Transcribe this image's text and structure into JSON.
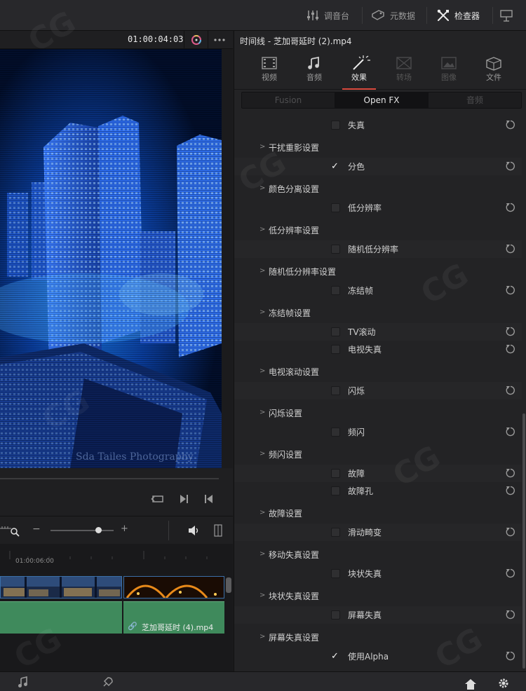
{
  "topbar": {
    "items": [
      {
        "label": "调音台",
        "icon": "mixer-icon"
      },
      {
        "label": "元数据",
        "icon": "metadata-tag-icon"
      },
      {
        "label": "检查器",
        "icon": "inspector-tools-icon"
      }
    ]
  },
  "viewer": {
    "timecode": "01:00:04:03",
    "overlay_text": "Sda Tailes Photography"
  },
  "timeline": {
    "ruler_timecode": "01:00:06:00",
    "audio_clip_name": "芝加哥延时 (4).mp4"
  },
  "inspector": {
    "title": "时间线 - 芝加哥延时 (2).mp4",
    "tabs": [
      {
        "label": "视频",
        "icon": "video-icon",
        "state": "normal"
      },
      {
        "label": "音频",
        "icon": "music-note-icon",
        "state": "normal"
      },
      {
        "label": "效果",
        "icon": "magic-wand-icon",
        "state": "active"
      },
      {
        "label": "转场",
        "icon": "transition-icon",
        "state": "dim"
      },
      {
        "label": "图像",
        "icon": "image-icon",
        "state": "dim"
      },
      {
        "label": "文件",
        "icon": "file-icon",
        "state": "normal"
      }
    ],
    "subtabs": [
      "Fusion",
      "Open FX",
      "音频"
    ],
    "active_subtab": "Open FX",
    "rows": [
      {
        "type": "check",
        "label": "失真",
        "checked": false
      },
      {
        "type": "group",
        "label": "干扰重影设置"
      },
      {
        "type": "check",
        "label": "分色",
        "checked": true
      },
      {
        "type": "group",
        "label": "颜色分离设置"
      },
      {
        "type": "check",
        "label": "低分辨率",
        "checked": false
      },
      {
        "type": "group",
        "label": "低分辨率设置"
      },
      {
        "type": "check",
        "label": "随机低分辨率",
        "checked": false
      },
      {
        "type": "group",
        "label": "随机低分辨率设置"
      },
      {
        "type": "check",
        "label": "冻结帧",
        "checked": false
      },
      {
        "type": "group",
        "label": "冻结帧设置"
      },
      {
        "type": "check",
        "label": "TV滚动",
        "checked": false
      },
      {
        "type": "check",
        "label": "电视失真",
        "checked": false
      },
      {
        "type": "group",
        "label": "电视滚动设置"
      },
      {
        "type": "check",
        "label": "闪烁",
        "checked": false
      },
      {
        "type": "group",
        "label": "闪烁设置"
      },
      {
        "type": "check",
        "label": "频闪",
        "checked": false
      },
      {
        "type": "group",
        "label": "频闪设置"
      },
      {
        "type": "check",
        "label": "故障",
        "checked": false
      },
      {
        "type": "check",
        "label": "故障孔",
        "checked": false
      },
      {
        "type": "group",
        "label": "故障设置"
      },
      {
        "type": "check",
        "label": "滑动畸变",
        "checked": false
      },
      {
        "type": "group",
        "label": "移动失真设置"
      },
      {
        "type": "check",
        "label": "块状失真",
        "checked": false
      },
      {
        "type": "group",
        "label": "块状失真设置"
      },
      {
        "type": "check",
        "label": "屏幕失真",
        "checked": false
      },
      {
        "type": "group",
        "label": "屏幕失真设置"
      },
      {
        "type": "check",
        "label": "使用Alpha",
        "checked": true
      }
    ]
  }
}
